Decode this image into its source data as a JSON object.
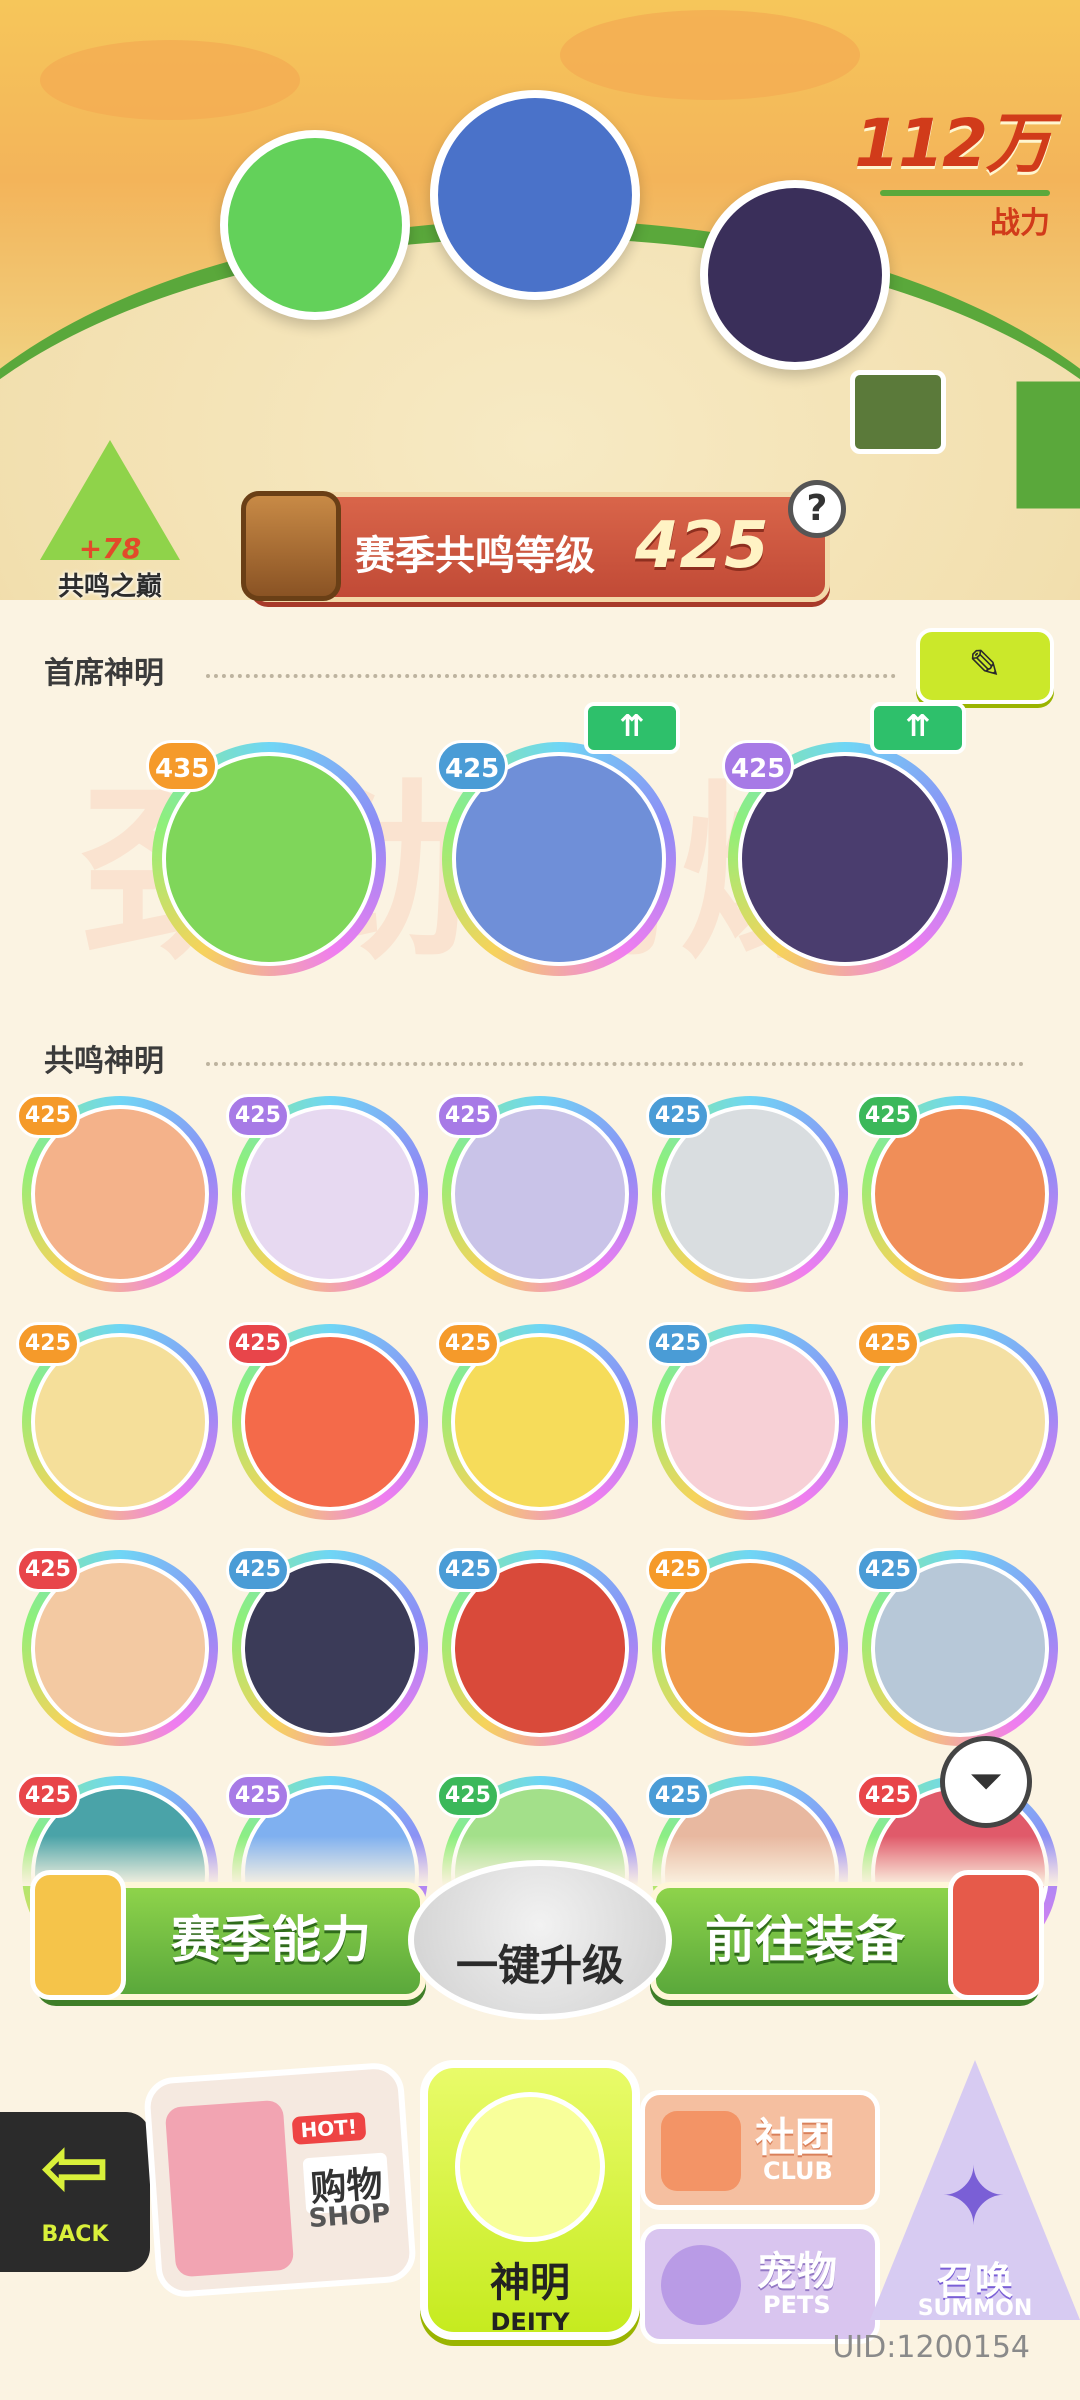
{
  "header": {
    "power_value": "112万",
    "power_label": "战力"
  },
  "peak": {
    "bonus": "+78",
    "name": "共鸣之巅"
  },
  "season": {
    "label": "赛季共鸣等级",
    "level": "425",
    "help": "?"
  },
  "sections": {
    "chief": "首席神明",
    "resonance": "共鸣神明",
    "watermark": "劲劲劲爆"
  },
  "chief_deities": [
    {
      "level": "435",
      "badge": "orange",
      "upgrade": false
    },
    {
      "level": "425",
      "badge": "blue",
      "upgrade": true
    },
    {
      "level": "425",
      "badge": "purple",
      "upgrade": true
    }
  ],
  "upgrade_icon": "double-up-arrow-icon",
  "resonance_deities": [
    {
      "level": "425",
      "badge": "orange"
    },
    {
      "level": "425",
      "badge": "purple"
    },
    {
      "level": "425",
      "badge": "purple"
    },
    {
      "level": "425",
      "badge": "blue"
    },
    {
      "level": "425",
      "badge": "green"
    },
    {
      "level": "425",
      "badge": "orange"
    },
    {
      "level": "425",
      "badge": "red"
    },
    {
      "level": "425",
      "badge": "orange"
    },
    {
      "level": "425",
      "badge": "blue"
    },
    {
      "level": "425",
      "badge": "orange"
    },
    {
      "level": "425",
      "badge": "red"
    },
    {
      "level": "425",
      "badge": "blue"
    },
    {
      "level": "425",
      "badge": "blue"
    },
    {
      "level": "425",
      "badge": "orange"
    },
    {
      "level": "425",
      "badge": "blue"
    },
    {
      "level": "425",
      "badge": "red"
    },
    {
      "level": "425",
      "badge": "purple"
    },
    {
      "level": "425",
      "badge": "green"
    },
    {
      "level": "425",
      "badge": "blue"
    },
    {
      "level": "425",
      "badge": "red"
    }
  ],
  "actions": {
    "season_ability": "赛季能力",
    "one_key_upgrade": "一键升级",
    "go_equip": "前往装备"
  },
  "nav": {
    "back": "BACK",
    "shop_hot": "HOT!",
    "shop_cn": "购物",
    "shop_en": "SHOP",
    "deity_cn": "神明",
    "deity_en": "DEITY",
    "club_cn": "社团",
    "club_en": "CLUB",
    "pets_cn": "宠物",
    "pets_en": "PETS",
    "summon_cn": "召唤",
    "summon_en": "SUMMON"
  },
  "uid": "UID:1200154",
  "colors": {
    "accent_green": "#5aa83b",
    "lime": "#cbe82a",
    "power_red": "#d13b1a",
    "banner_red": "#c14a36"
  }
}
